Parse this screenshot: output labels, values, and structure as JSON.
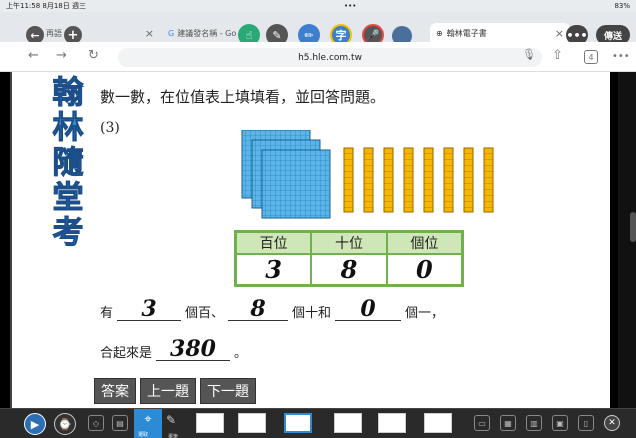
{
  "status": {
    "time": "上午11:58 8月18日 週三",
    "dots": "•••",
    "battery": "83%"
  },
  "tabs": [
    {
      "label": "再語"
    },
    {
      "label": "建議發名稱 - Go"
    },
    {
      "label": "翰林電子書"
    }
  ],
  "tabbar": {
    "send_label": "傳送",
    "ai_label": "字"
  },
  "address": {
    "url": "h5.hle.com.tw",
    "tab_count": "4"
  },
  "book": {
    "side_title": [
      "翰",
      "林",
      "隨",
      "堂",
      "考"
    ],
    "question": "數一數，在位值表上填填看，並回答問題。",
    "sub_number": "(3)",
    "table_headers": [
      "百位",
      "十位",
      "個位"
    ],
    "table_values": [
      "3",
      "8",
      "0"
    ],
    "line1": {
      "p1": "有",
      "a1": "3",
      "p2": "個百、",
      "a2": "8",
      "p3": "個十和",
      "a3": "0",
      "p4": "個一，"
    },
    "line2": {
      "p1": "合起來是",
      "a1": "380",
      "p2": "。"
    },
    "buttons": {
      "answer": "答案",
      "prev": "上一題",
      "next": "下一題"
    }
  },
  "toolbar_labels": {
    "select": "選取",
    "pen": "畫筆"
  },
  "blocks": {
    "hundreds": 3,
    "tens": 8,
    "ones": 0
  }
}
